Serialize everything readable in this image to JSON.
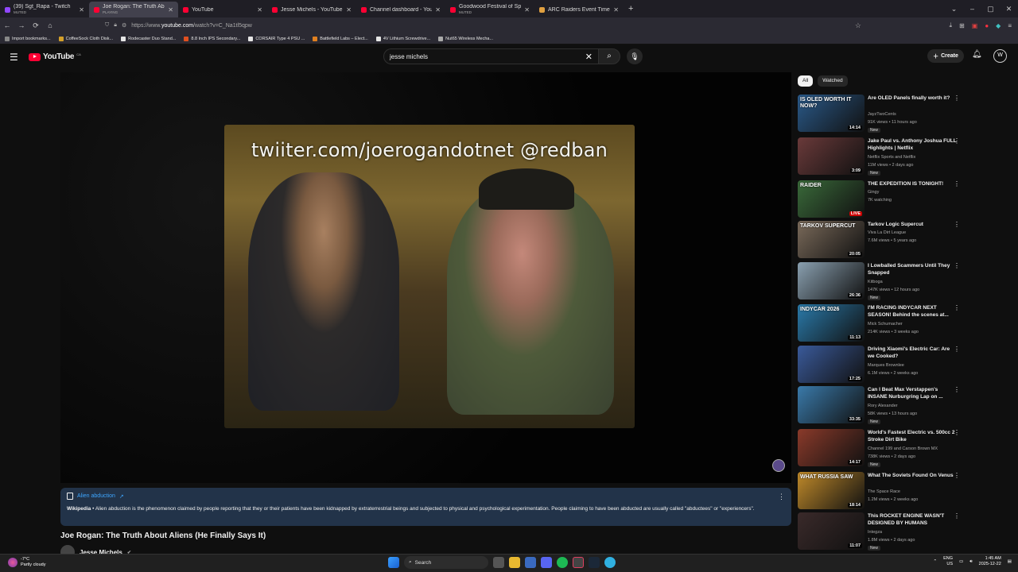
{
  "browser": {
    "tabs": [
      {
        "title": "(39) Sgt_Rapa - Twitch",
        "sub": "MUTED",
        "color": "#9147ff"
      },
      {
        "title": "Joe Rogan: The Truth About Ali",
        "sub": "PLAYING",
        "color": "#ff0033",
        "active": true
      },
      {
        "title": "YouTube",
        "sub": "",
        "color": "#ff0033"
      },
      {
        "title": "Jesse Michels - YouTube",
        "sub": "",
        "color": "#ff0033"
      },
      {
        "title": "Channel dashboard - YouTube",
        "sub": "",
        "color": "#ff0033"
      },
      {
        "title": "Goodwood Festival of Speed -",
        "sub": "MUTED",
        "color": "#ff0033"
      },
      {
        "title": "ARC Raiders Event Timers | Met",
        "sub": "",
        "color": "#e0a040"
      }
    ],
    "url_prefix": "https://www.",
    "url_host": "youtube.com",
    "url_path": "/watch?v=C_Na1tl5qpw",
    "bookmarks": [
      {
        "label": "Import bookmarks...",
        "color": "#888"
      },
      {
        "label": "CoffeeSock Cloth Disk...",
        "color": "#d4a02a"
      },
      {
        "label": "Rodecaster Duo Stand...",
        "color": "#e6e6e6"
      },
      {
        "label": "8.8 Inch IPS Secondary...",
        "color": "#e05020"
      },
      {
        "label": "CORSAIR Type 4 PSU ...",
        "color": "#e6e6e6"
      },
      {
        "label": "Battlefield Labs – Elect...",
        "color": "#e08020"
      },
      {
        "label": "4V Lithium Screwdrive...",
        "color": "#e6e6e6"
      },
      {
        "label": "Nut65 Wireless Mecha...",
        "color": "#aaa"
      }
    ]
  },
  "youtube": {
    "logo_text": "YouTube",
    "region": "CA",
    "search_value": "jesse michels",
    "create_label": "Create",
    "avatar_letter": "W"
  },
  "player": {
    "overlay_caption": "twiiter.com/joerogandotnet @redban"
  },
  "info_panel": {
    "link": "Alien abduction",
    "source": "Wikipedia",
    "text": " • Alien abduction is the phenomenon claimed by people reporting that they or their patients have been kidnapped by extraterrestrial beings and subjected to physical and psychological experimentation. People claiming to have been abducted are usually called \"abductees\" or \"experiencers\"."
  },
  "video": {
    "title": "Joe Rogan: The Truth About Aliens (He Finally Says It)",
    "channel": "Jesse Michels"
  },
  "sidebar": {
    "chips": [
      "All",
      "Watched"
    ],
    "recs": [
      {
        "title": "Are OLED Panels finally worth it?",
        "channel": "JayzTwoCents",
        "meta": "91K views • 11 hours ago",
        "badge": "New",
        "duration": "14:14",
        "thumb": "#2a5a8a",
        "thumb_text": "IS OLED WORTH IT NOW?"
      },
      {
        "title": "Jake Paul vs. Anthony Joshua FULL Highlights | Netflix",
        "channel": "Netflix Sports and Netflix",
        "meta": "11M views • 2 days ago",
        "badge": "New",
        "duration": "3:09",
        "thumb": "#6a3a3a",
        "thumb_text": ""
      },
      {
        "title": "THE EXPEDITION IS TONIGHT!",
        "channel": "Gingy",
        "meta": "7K watching",
        "badge": "",
        "duration": "LIVE",
        "thumb": "#3a6a3a",
        "thumb_text": "RAIDER"
      },
      {
        "title": "Tarkov Logic Supercut",
        "channel": "Viva La Dirt League",
        "meta": "7.6M views • 5 years ago",
        "badge": "",
        "duration": "20:05",
        "thumb": "#7a6a5a",
        "thumb_text": "TARKOV SUPERCUT"
      },
      {
        "title": "I Lowballed Scammers Until They Snapped",
        "channel": "Kitboga",
        "meta": "147K views • 12 hours ago",
        "badge": "New",
        "duration": "26:36",
        "thumb": "#8aa0b0",
        "thumb_text": ""
      },
      {
        "title": "I'M RACING INDYCAR NEXT SEASON! Behind the scenes at...",
        "channel": "Mick Schumacher",
        "meta": "214K views • 3 weeks ago",
        "badge": "",
        "duration": "11:13",
        "thumb": "#2a7aaa",
        "thumb_text": "INDYCAR 2026"
      },
      {
        "title": "Driving Xiaomi's Electric Car: Are we Cooked?",
        "channel": "Marques Brownlee",
        "meta": "6.1M views • 2 weeks ago",
        "badge": "",
        "duration": "17:25",
        "thumb": "#3a5a9a",
        "thumb_text": ""
      },
      {
        "title": "Can I Beat Max Verstappen's INSANE Nurburgring Lap on ...",
        "channel": "Rory Alexander",
        "meta": "58K views • 13 hours ago",
        "badge": "New",
        "duration": "33:35",
        "thumb": "#3a7aaa",
        "thumb_text": ""
      },
      {
        "title": "World's Fastest Electric vs. 500cc 2 Stroke Dirt Bike",
        "channel": "Channel 199 and Carson Brown MX",
        "meta": "738K views • 2 days ago",
        "badge": "New",
        "duration": "14:17",
        "thumb": "#8a3a2a",
        "thumb_text": ""
      },
      {
        "title": "What The Soviets Found On Venus",
        "channel": "The Space Race",
        "meta": "1.2M views • 2 weeks ago",
        "badge": "",
        "duration": "18:14",
        "thumb": "#c08a2a",
        "thumb_text": "WHAT RUSSIA SAW"
      },
      {
        "title": "This ROCKET ENGINE WASN'T DESIGNED BY HUMANS",
        "channel": "Integza",
        "meta": "1.8M views • 2 days ago",
        "badge": "New",
        "duration": "11:07",
        "thumb": "#3a2a2a",
        "thumb_text": ""
      }
    ]
  },
  "taskbar": {
    "temp": "-7°C",
    "condition": "Partly cloudy",
    "search_label": "Search",
    "lang1": "ENG",
    "lang2": "US",
    "time": "1:45 AM",
    "date": "2025-12-22"
  }
}
